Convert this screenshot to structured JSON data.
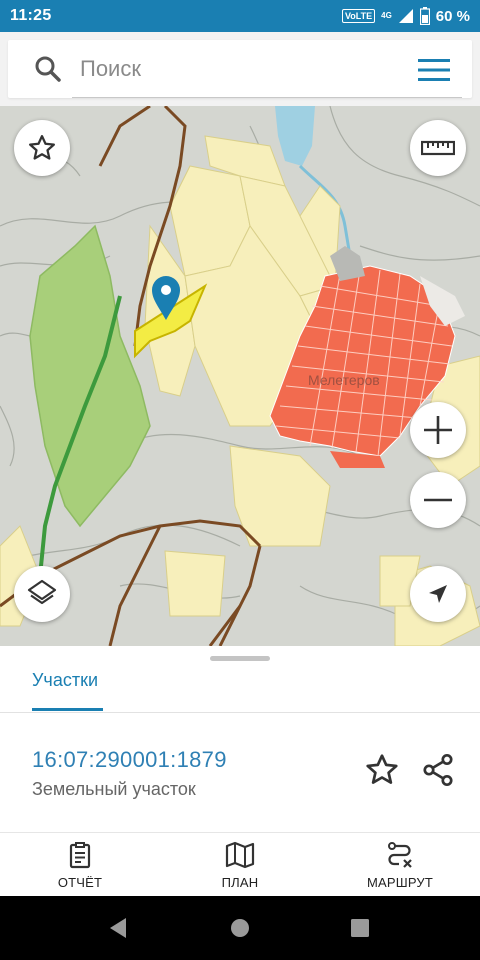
{
  "status_bar": {
    "time": "11:25",
    "volte": "VoLTE",
    "network": "4G",
    "battery": "60 %"
  },
  "search": {
    "placeholder": "Поиск"
  },
  "map": {
    "label": "Мелетеров",
    "selected_parcel_color": "#f3ec44",
    "settlement_color": "#f26b4f",
    "forest_color": "#a8cf7a",
    "farmland_color": "#f7efbb"
  },
  "sheet": {
    "tab_label": "Участки",
    "parcel_id": "16:07:290001:1879",
    "parcel_type": "Земельный участок"
  },
  "bottom_nav": {
    "report": "ОТЧЁТ",
    "plan": "ПЛАН",
    "route": "МАРШРУТ"
  },
  "colors": {
    "accent": "#1a7fb2",
    "link": "#2f80b4"
  }
}
